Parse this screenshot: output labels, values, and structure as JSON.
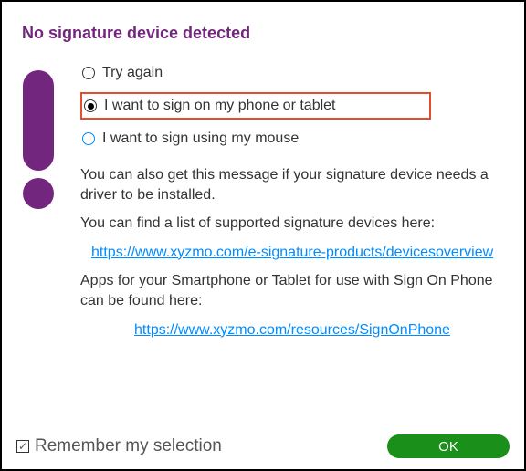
{
  "title": "No signature device detected",
  "options": {
    "try_again": {
      "label": "Try again",
      "selected": false
    },
    "phone_tablet": {
      "label": "I want to sign on my phone or tablet",
      "selected": true,
      "highlighted": true
    },
    "mouse": {
      "label": "I want to sign using my mouse",
      "selected": false
    }
  },
  "info": {
    "driver_msg": "You can also get this message if your signature device needs a driver to be installed.",
    "devices_msg": "You can find a list of supported signature devices here:",
    "devices_link": "https://www.xyzmo.com/e-signature-products/devicesoverview",
    "apps_msg": "Apps for your Smartphone or Tablet for use with Sign On Phone can be found here:",
    "apps_link": "https://www.xyzmo.com/resources/SignOnPhone"
  },
  "footer": {
    "remember_label": "Remember my selection",
    "remember_checked": true,
    "ok_label": "OK"
  }
}
